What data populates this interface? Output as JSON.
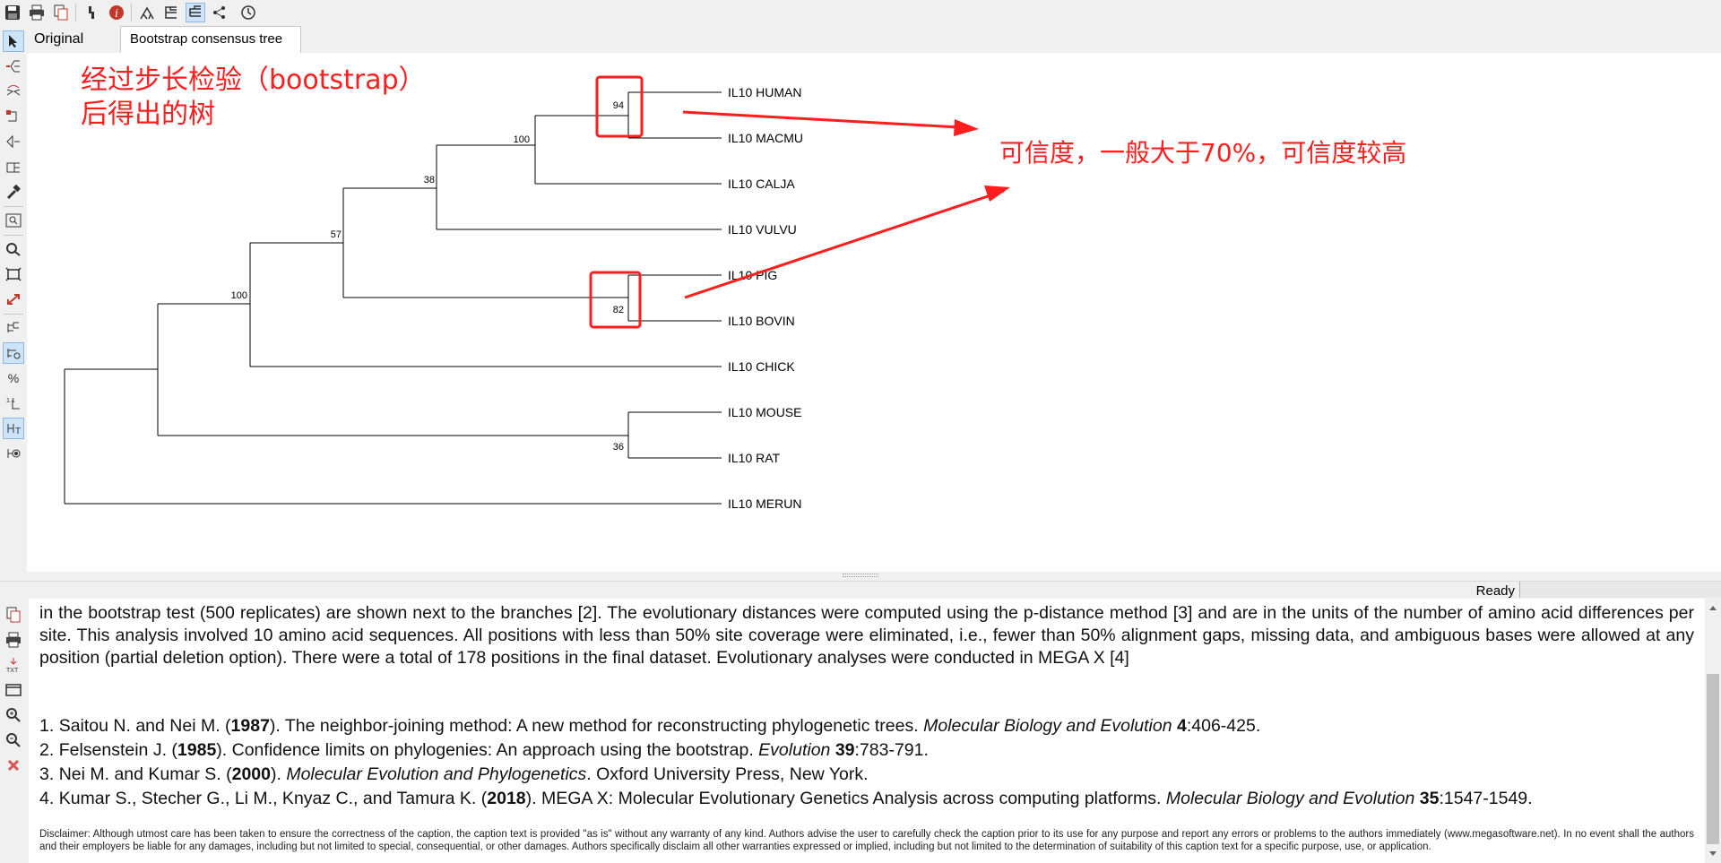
{
  "toolbar": {
    "icons": [
      "save-icon",
      "print-icon",
      "copy-icon",
      "wrench-icon",
      "info-icon",
      "tree-style-1-icon",
      "tree-style-2-icon",
      "tree-style-3-icon",
      "taxa-icon",
      "clock-icon"
    ]
  },
  "tabs": [
    {
      "label": "Original Tree"
    },
    {
      "label": "Bootstrap consensus tree"
    }
  ],
  "tree": {
    "taxa": [
      "IL10 HUMAN",
      "IL10 MACMU",
      "IL10 CALJA",
      "IL10 VULVU",
      "IL10 PIG",
      "IL10 BOVIN",
      "IL10 CHICK",
      "IL10 MOUSE",
      "IL10 RAT",
      "IL10 MERUN"
    ],
    "bootstrap": {
      "human_macmu": "94",
      "calja_clade": "100",
      "vulvu_clade": "38",
      "mammal_clade": "57",
      "pig_bovin": "82",
      "chick_clade": "100",
      "mouse_rat": "36"
    }
  },
  "annotations": {
    "left_line1": "经过步长检验（bootstrap）",
    "left_line2": "后得出的树",
    "right": "可信度，一般大于70%，可信度较高",
    "color": "#ff1e1e"
  },
  "status": {
    "text": "Ready"
  },
  "caption": {
    "paragraph": "in the bootstrap test (500 replicates) are shown next to the branches [2]. The evolutionary distances were computed using the p-distance method [3] and are in the units of the number of amino acid differences per site. This analysis involved 10 amino acid sequences. All positions with less than 50% site coverage were eliminated, i.e., fewer than 50% alignment gaps, missing data, and ambiguous bases were allowed at any position (partial deletion option). There were a total of 178 positions in the final dataset. Evolutionary analyses were conducted in MEGA X [4]",
    "refs": [
      {
        "num": "1.",
        "authors": "Saitou N. and Nei M. (",
        "year": "1987",
        "title": "). The neighbor-joining method: A new method for reconstructing phylogenetic trees. ",
        "journal": "Molecular Biology and Evolution",
        "vol": "4",
        "pages": ":406-425."
      },
      {
        "num": "2.",
        "authors": "Felsenstein J. (",
        "year": "1985",
        "title": "). Confidence limits on phylogenies: An approach using the bootstrap. ",
        "journal": "Evolution",
        "vol": "39",
        "pages": ":783-791."
      },
      {
        "num": "3.",
        "authors": "Nei M. and Kumar S. (",
        "year": "2000",
        "title": "). ",
        "journal": "Molecular Evolution and Phylogenetics",
        "vol": "",
        "pages": ". Oxford University Press, New York."
      },
      {
        "num": "4.",
        "authors": "Kumar S., Stecher G., Li M., Knyaz C., and Tamura K. (",
        "year": "2018",
        "title": "). MEGA X: Molecular Evolutionary Genetics Analysis across computing platforms. ",
        "journal": "Molecular Biology and Evolution",
        "vol": "35",
        "pages": ":1547-1549."
      }
    ],
    "disclaimer": "Disclaimer: Although utmost care has been taken to ensure the correctness of the caption, the caption text is provided \"as is\" without any warranty of any kind. Authors advise the user to carefully check the caption prior to its use for any purpose and report any errors or problems to the authors immediately (www.megasoftware.net). In no event shall the authors and their employers be liable for any damages, including but not limited to special, consequential, or other damages. Authors specifically disclaim all other warranties expressed or implied, including but not limited to the determination of suitability of this caption text for a specific purpose, use, or application."
  }
}
